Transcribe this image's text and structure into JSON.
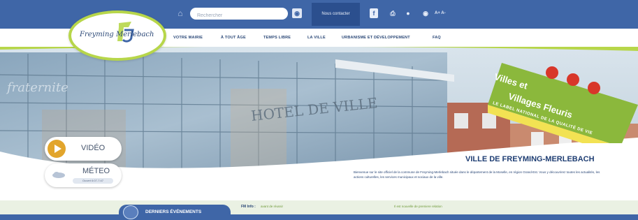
{
  "colors": {
    "topbar": "#3f66a7",
    "contact": "#2b4f8e",
    "nav_text": "#2b4877",
    "accent_green": "#b7d64a",
    "banner_green": "#8bb83c",
    "banner_yellow": "#f2e253",
    "play": "#e2a52c"
  },
  "topbar": {
    "home_icon": "home-icon",
    "search_placeholder": "Rechercher",
    "search_icon": "search-icon",
    "rss_icon": "rss-icon",
    "contact_label": "Nous contacter",
    "facebook_icon": "facebook-icon",
    "print_icon": "print-icon",
    "account_icon": "person-icon",
    "contrast_icon": "eye-icon",
    "font_size": "A+ A-"
  },
  "logo": {
    "text": "Freyming Merlebach"
  },
  "nav": {
    "items": [
      {
        "label": "VOTRE MAIRIE"
      },
      {
        "label": "À TOUT ÂGE"
      },
      {
        "label": "TEMPS LIBRE"
      },
      {
        "label": "LA VILLE"
      },
      {
        "label": "URBANISME ET DÉVELOPPEMENT"
      },
      {
        "label": "FAQ"
      }
    ]
  },
  "hero": {
    "building_sign": "HOTEL DE VILLE",
    "facade_text": "fraternite"
  },
  "media": {
    "video_label": "VIDÉO",
    "meteo_label": "MÉTEO",
    "meteo_sub": "Ouvert 6:07-7:47"
  },
  "banner": {
    "line1": "Villes et",
    "line2": "Villages Fleuris",
    "subtitle": "LE LABEL NATIONAL DE LA QUALITÉ DE VIE"
  },
  "welcome": {
    "title": "VILLE DE FREYMING-MERLEBACH",
    "text": "Bienvenue sur le site officiel de la commune de Freyming-Merlebach située dans le département de la Moselle, en région Grand-Est. Vous y découvrirez toutes les actualités, les actions culturelles, les services municipaux et sociaux de la ville."
  },
  "info": {
    "label": "FM Info :",
    "item1": "avant de réussir",
    "item2": "Il est nouvelle de premiere relation"
  },
  "events": {
    "label": "DERNIERS ÉVÉNEMENTS",
    "icon": "calendar-icon"
  }
}
